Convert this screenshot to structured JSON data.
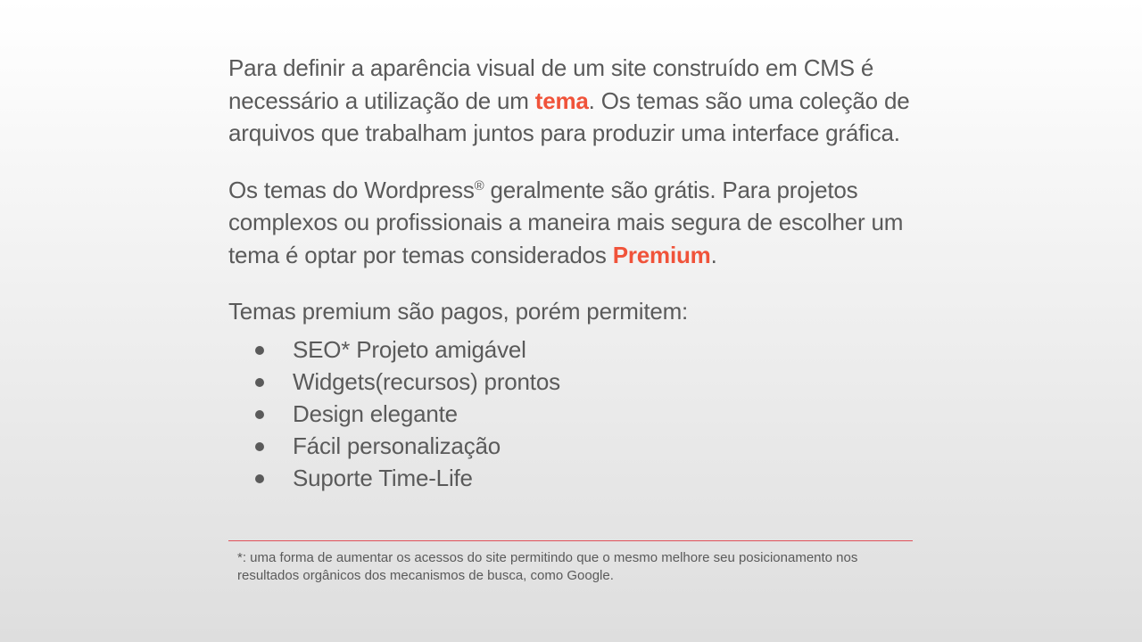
{
  "paragraph1": {
    "before": "Para definir a aparência visual de um site construído em CMS é necessário a utilização de um ",
    "highlight": "tema",
    "after": ". Os temas são uma coleção de arquivos que trabalham juntos para produzir uma interface gráfica."
  },
  "paragraph2": {
    "before": "Os temas do Wordpress",
    "registered_mark": "®",
    "middle": " geralmente são grátis. Para projetos complexos ou profissionais a maneira mais segura de escolher um tema é optar por temas considerados ",
    "highlight": "Premium",
    "after": "."
  },
  "paragraph3": {
    "text": "Temas premium são pagos, porém permitem:"
  },
  "features": [
    "SEO* Projeto amigável",
    "Widgets(recursos) prontos",
    "Design elegante",
    "Fácil personalização",
    "Suporte Time-Life"
  ],
  "footnote": {
    "marker": "*",
    "text": ": uma forma de aumentar os acessos do site permitindo que o mesmo melhore seu posicionamento nos resultados orgânicos dos mecanismos de busca, como Google."
  },
  "colors": {
    "text": "#5a5a5a",
    "accent": "#f0533a",
    "rule": "#e0505a"
  }
}
